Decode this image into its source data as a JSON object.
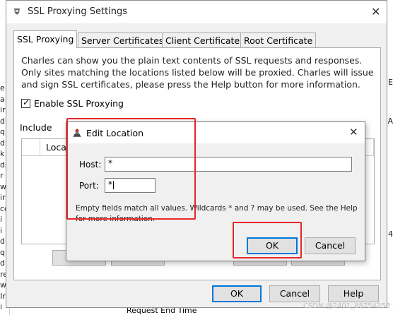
{
  "background": {
    "left_fragments": [
      "e",
      "a",
      "ir",
      "d.",
      "q",
      "d.",
      "k",
      "ds",
      "r",
      "w",
      "ir",
      "co",
      "i",
      "i",
      "d.",
      "q",
      "d.",
      "re",
      "w",
      "Ir",
      "i"
    ],
    "right_fragments": [
      "E",
      "A",
      "4"
    ],
    "bottom_text": "Request End Time"
  },
  "main_dialog": {
    "title": "SSL Proxying Settings",
    "tabs": [
      {
        "label": "SSL Proxying",
        "active": true
      },
      {
        "label": "Server Certificates",
        "active": false
      },
      {
        "label": "Client Certificates",
        "active": false
      },
      {
        "label": "Root Certificate",
        "active": false
      }
    ],
    "description": "Charles can show you the plain text contents of SSL requests and responses. Only sites matching the locations listed below will be proxied. Charles will issue and sign SSL certificates, please press the Help button for more information.",
    "enable_label": "Enable SSL Proxying",
    "enable_checked": true,
    "include_label": "Include",
    "table_header_partial": "Locat",
    "buttons": {
      "ok": "OK",
      "cancel": "Cancel",
      "help": "Help"
    }
  },
  "edit_location": {
    "title": "Edit Location",
    "host_label": "Host:",
    "host_value": "*",
    "port_label": "Port:",
    "port_value": "*",
    "note": "Empty fields match all values. Wildcards * and ? may be used. See the Help for more information.",
    "ok_label": "OK",
    "cancel_label": "Cancel"
  },
  "annotation_color": "#e8262a",
  "accent_color": "#0078d7",
  "watermark": "CSDN @2401_88754256"
}
